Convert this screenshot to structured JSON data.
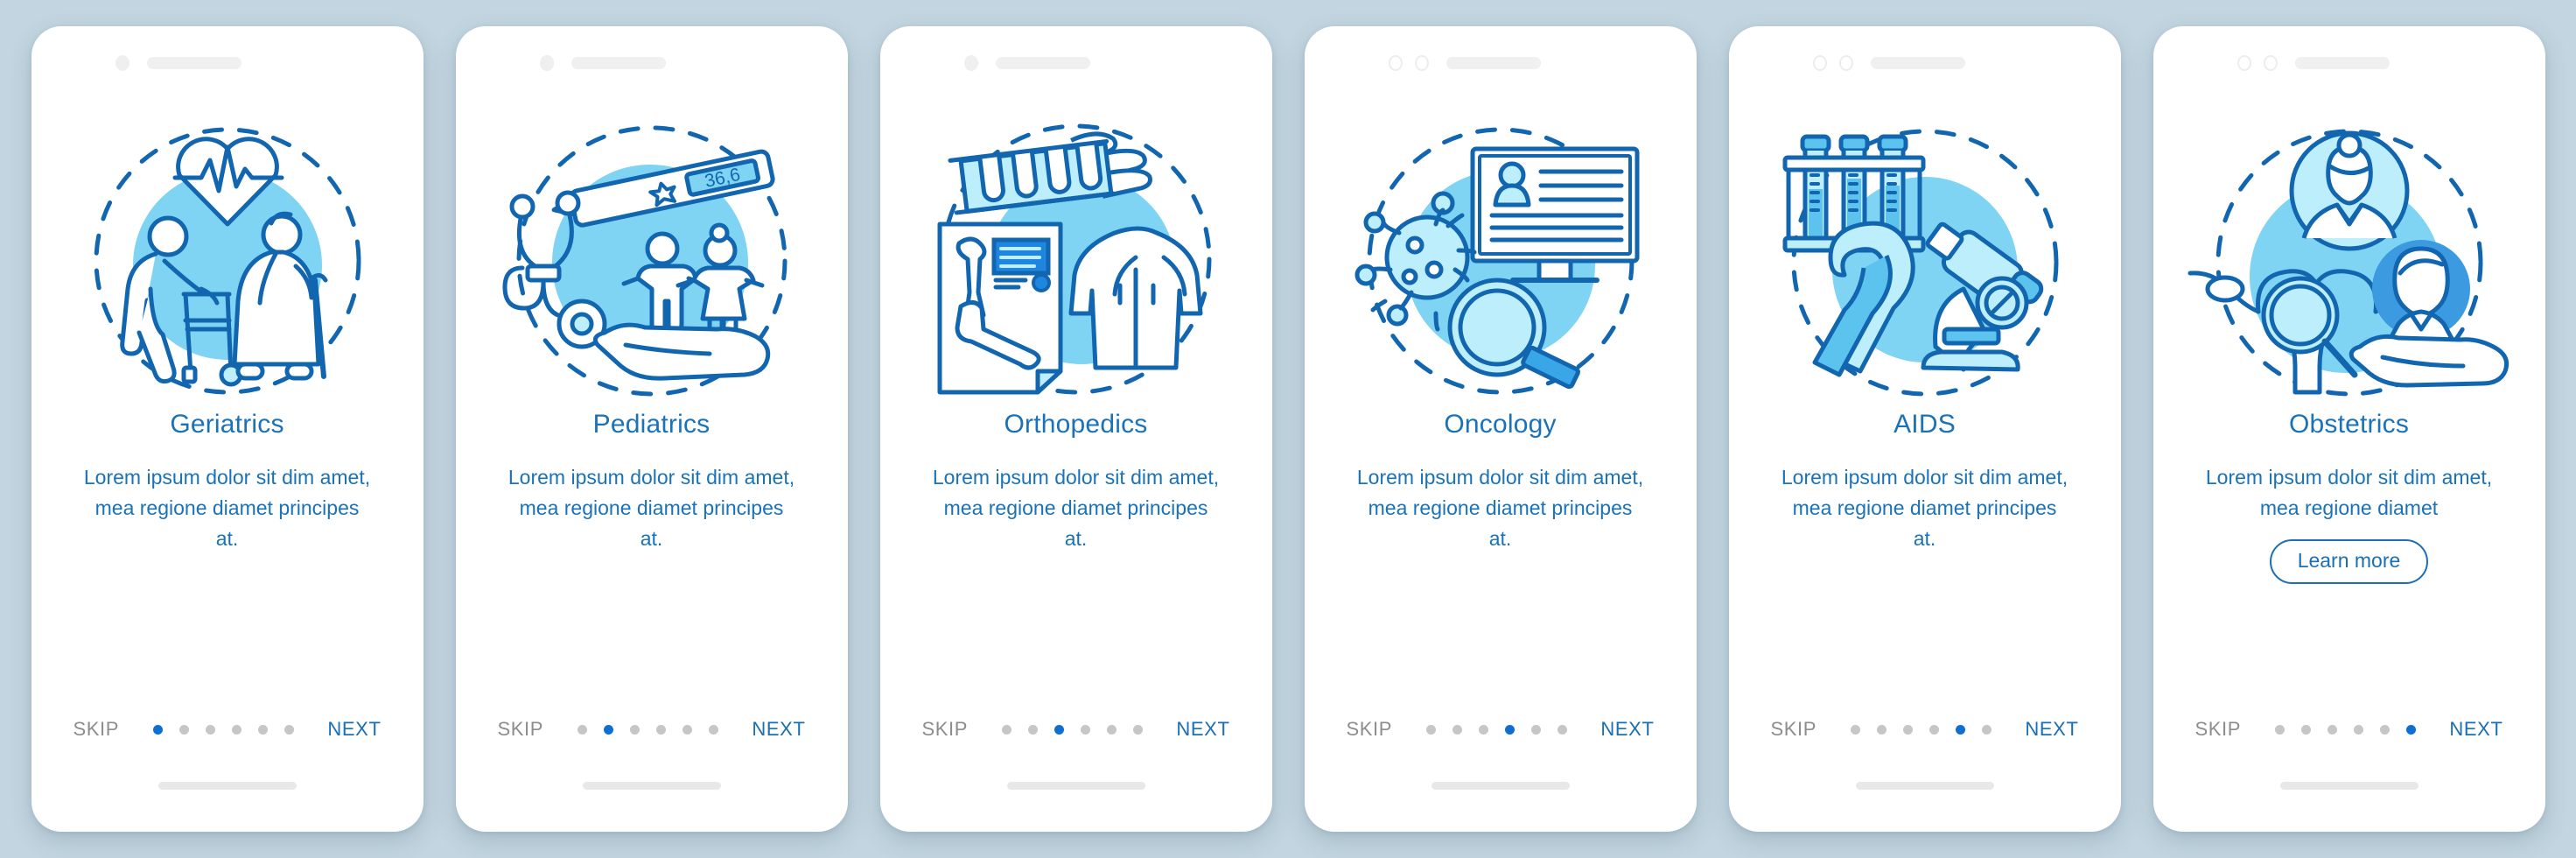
{
  "colors": {
    "background": "#c2d5e0",
    "card": "#ffffff",
    "accent_blue": "#1a72b8",
    "stroke_blue": "#1266b0",
    "fill_light_blue": "#7fd4f4",
    "fill_pale_blue": "#bdeefb",
    "dot_active": "#0e6fd1",
    "dot_inactive": "#c6c6c6",
    "skip_gray": "#8d8d8d"
  },
  "nav": {
    "skip_label": "SKIP",
    "next_label": "NEXT",
    "total_dots": 6
  },
  "screens": [
    {
      "title": "Geriatrics",
      "body": "Lorem ipsum dolor sit dim amet, mea regione diamet principes at.",
      "active_dot": 1,
      "camera_count": 1,
      "illustration": "geriatrics-illustration",
      "button": null
    },
    {
      "title": "Pediatrics",
      "body": "Lorem ipsum dolor sit dim amet, mea regione diamet principes at.",
      "active_dot": 2,
      "camera_count": 1,
      "illustration": "pediatrics-illustration",
      "thermometer_reading": "36,6",
      "button": null
    },
    {
      "title": "Orthopedics",
      "body": "Lorem ipsum dolor sit dim amet, mea regione diamet principes at.",
      "active_dot": 3,
      "camera_count": 1,
      "illustration": "orthopedics-illustration",
      "button": null
    },
    {
      "title": "Oncology",
      "body": "Lorem ipsum dolor sit dim amet, mea regione diamet principes at.",
      "active_dot": 4,
      "camera_count": 2,
      "illustration": "oncology-illustration",
      "button": null
    },
    {
      "title": "AIDS",
      "body": "Lorem ipsum dolor sit dim amet, mea regione diamet principes at.",
      "active_dot": 5,
      "camera_count": 2,
      "illustration": "aids-illustration",
      "button": null
    },
    {
      "title": "Obstetrics",
      "body": "Lorem ipsum dolor sit dim amet, mea regione diamet",
      "active_dot": 6,
      "camera_count": 2,
      "illustration": "obstetrics-illustration",
      "button": "Learn more"
    }
  ]
}
